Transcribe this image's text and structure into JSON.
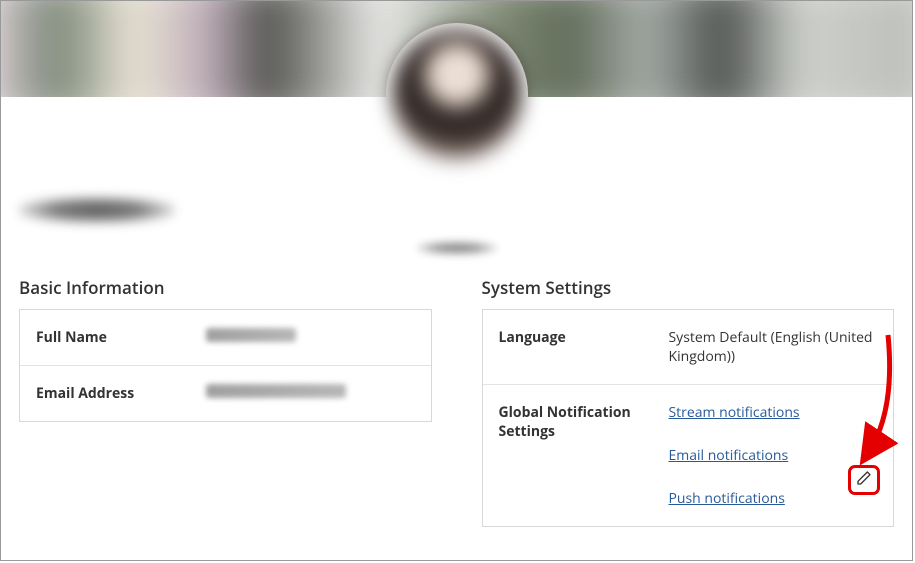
{
  "sections": {
    "basic_info": {
      "title": "Basic Information",
      "rows": {
        "full_name_label": "Full Name",
        "email_label": "Email Address"
      }
    },
    "system_settings": {
      "title": "System Settings",
      "rows": {
        "language_label": "Language",
        "language_value": "System Default (English (United Kingdom))",
        "notifications_label": "Global Notification Settings",
        "links": {
          "stream": "Stream notifications",
          "email": "Email notifications",
          "push": "Push notifications"
        }
      }
    }
  },
  "annotation": {
    "highlight": "edit-email-notifications"
  }
}
